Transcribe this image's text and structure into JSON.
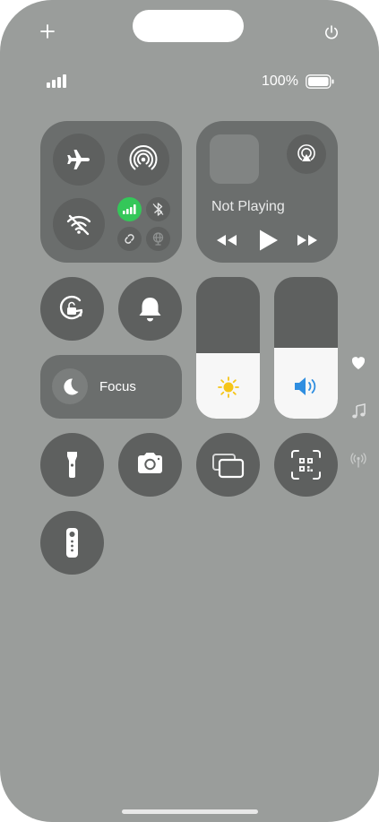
{
  "status": {
    "battery_text": "100%"
  },
  "media": {
    "title": "Not Playing"
  },
  "focus": {
    "label": "Focus"
  },
  "sliders": {
    "brightness_level": 0.46,
    "volume_level": 0.5
  },
  "colors": {
    "background": "#9a9d9b",
    "cellular_green": "#34c759",
    "volume_blue": "#2f8ee0",
    "brightness_yellow": "#f5c518"
  },
  "icons": [
    "plus-icon",
    "power-icon",
    "signal-icon",
    "battery-icon",
    "airplane-icon",
    "airdrop-icon",
    "wifi-off-icon",
    "cellular-icon",
    "bluetooth-off-icon",
    "personal-hotspot-icon",
    "globe-icon",
    "airplay-icon",
    "rewind-icon",
    "play-icon",
    "fast-forward-icon",
    "rotation-lock-icon",
    "bell-icon",
    "moon-icon",
    "sun-icon",
    "speaker-icon",
    "heart-icon",
    "music-note-icon",
    "antenna-icon",
    "flashlight-icon",
    "camera-icon",
    "screen-mirroring-icon",
    "qr-scanner-icon",
    "remote-icon"
  ]
}
